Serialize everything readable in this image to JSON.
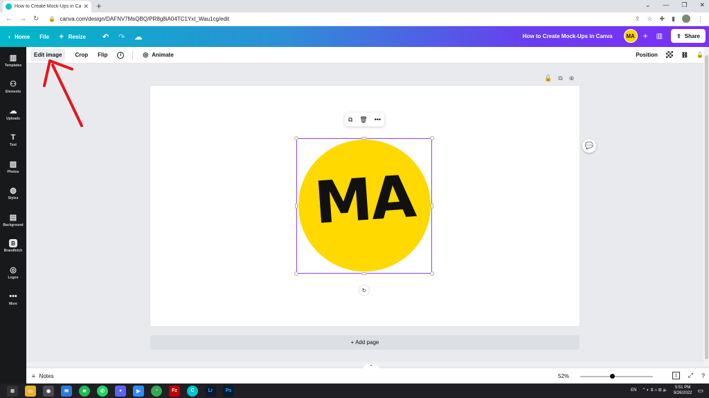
{
  "browser": {
    "tab_title": "How to Create Mock-Ups in Canva",
    "tab_close": "✕",
    "new_tab": "+",
    "url": "canva.com/design/DAFNV7MsQBQ/PR8g8iA04TC1YxI_Wau1cg/edit"
  },
  "header": {
    "home": "Home",
    "file": "File",
    "resize": "Resize",
    "doc_title": "How to Create Mock-Ups in Canva",
    "avatar": "MA",
    "share": "Share"
  },
  "sidebar": {
    "items": [
      {
        "label": "Templates",
        "icon": "▥"
      },
      {
        "label": "Elements",
        "icon": "⚇"
      },
      {
        "label": "Uploads",
        "icon": "☁"
      },
      {
        "label": "Text",
        "icon": "T"
      },
      {
        "label": "Photos",
        "icon": "▨"
      },
      {
        "label": "Styles",
        "icon": "◍"
      },
      {
        "label": "Background",
        "icon": "▤"
      },
      {
        "label": "Brandfetch",
        "icon": "B"
      },
      {
        "label": "Logos",
        "icon": "◎"
      },
      {
        "label": "More",
        "icon": "•••"
      }
    ]
  },
  "toolbar": {
    "edit_image": "Edit image",
    "crop": "Crop",
    "flip": "Flip",
    "info": "i",
    "animate": "Animate",
    "position": "Position"
  },
  "canvas": {
    "logo_text": "MA",
    "logo_color": "#ffd900",
    "add_page": "+ Add page"
  },
  "footer": {
    "notes": "Notes",
    "zoom": "52%",
    "page_count": "1"
  },
  "taskbar": {
    "lang": "EN",
    "time": "5:51 PM",
    "date": "9/26/2022"
  },
  "colors": {
    "accent": "#8b3dff",
    "annotation": "#e8141b"
  }
}
